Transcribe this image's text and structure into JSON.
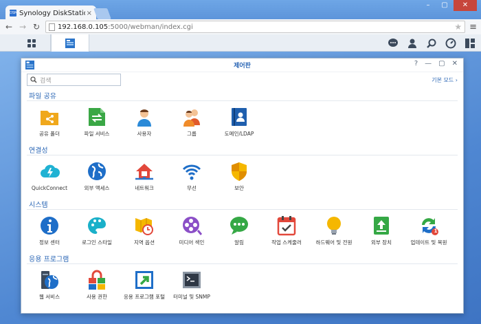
{
  "browser": {
    "tab_title": "Synology DiskStation",
    "tab_close": "×",
    "favicon_text": "DSM",
    "url_host": "192.168.0.105",
    "url_rest": ":5000/webman/index.cgi",
    "window_controls": [
      "–",
      "▢",
      "✕"
    ]
  },
  "window": {
    "title": "제어판",
    "search_placeholder": "검색",
    "mode_link": "기본 모드 ›",
    "controls": [
      "?",
      "—",
      "▢",
      "✕"
    ]
  },
  "sections": [
    {
      "title": "파일 공유",
      "items": [
        {
          "label": "공유 폴더",
          "icon": "shared-folder-icon"
        },
        {
          "label": "파일 서비스",
          "icon": "file-services-icon"
        },
        {
          "label": "사용자",
          "icon": "user-icon"
        },
        {
          "label": "그룹",
          "icon": "group-icon"
        },
        {
          "label": "도메인/LDAP",
          "icon": "domain-ldap-icon"
        }
      ]
    },
    {
      "title": "연결성",
      "items": [
        {
          "label": "QuickConnect",
          "icon": "quickconnect-icon"
        },
        {
          "label": "외부 액세스",
          "icon": "external-access-icon"
        },
        {
          "label": "네트워크",
          "icon": "network-icon"
        },
        {
          "label": "무선",
          "icon": "wireless-icon"
        },
        {
          "label": "보안",
          "icon": "security-icon"
        }
      ]
    },
    {
      "title": "시스템",
      "items": [
        {
          "label": "정보 센터",
          "icon": "info-center-icon"
        },
        {
          "label": "로그인 스타일",
          "icon": "login-style-icon"
        },
        {
          "label": "지역 옵션",
          "icon": "regional-options-icon"
        },
        {
          "label": "미디어 색인",
          "icon": "media-index-icon"
        },
        {
          "label": "알림",
          "icon": "notification-icon"
        },
        {
          "label": "작업 스케줄러",
          "icon": "task-scheduler-icon"
        },
        {
          "label": "하드웨어 및 전원",
          "icon": "hardware-power-icon"
        },
        {
          "label": "외부 장치",
          "icon": "external-devices-icon"
        },
        {
          "label": "업데이트 및 복원",
          "icon": "update-restore-icon",
          "badge": "1"
        }
      ]
    },
    {
      "title": "응용 프로그램",
      "items": [
        {
          "label": "웹 서비스",
          "icon": "web-services-icon"
        },
        {
          "label": "사용 권한",
          "icon": "privileges-icon"
        },
        {
          "label": "응용 프로그램 포털",
          "icon": "application-portal-icon"
        },
        {
          "label": "터미널 및 SNMP",
          "icon": "terminal-snmp-icon"
        }
      ]
    }
  ],
  "colors": {
    "accent": "#2a66b5",
    "desktop": "#4f87d2"
  }
}
